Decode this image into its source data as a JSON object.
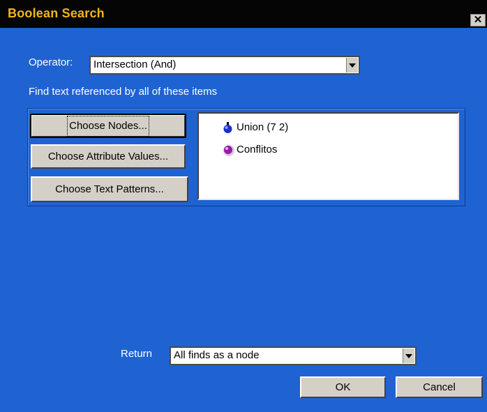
{
  "window": {
    "title": "Boolean Search",
    "close_glyph": "✕"
  },
  "operator": {
    "label": "Operator:",
    "value": "Intersection (And)"
  },
  "instruction": "Find text referenced by all of these items",
  "buttons": {
    "choose_nodes": "Choose Nodes...",
    "choose_attribute_values": "Choose Attribute Values...",
    "choose_text_patterns": "Choose Text Patterns..."
  },
  "items": [
    {
      "label": "Union (7 2)",
      "icon": "blue-node-icon",
      "color": "#1a2fd6"
    },
    {
      "label": "Conflitos",
      "icon": "purple-node-icon",
      "color": "#9c1aa8"
    }
  ],
  "return": {
    "label": "Return",
    "value": "All finds as a node"
  },
  "ok_label": "OK",
  "cancel_label": "Cancel",
  "colors": {
    "background": "#1e63d3",
    "title_bar": "#050505",
    "title_text": "#f1b617"
  }
}
